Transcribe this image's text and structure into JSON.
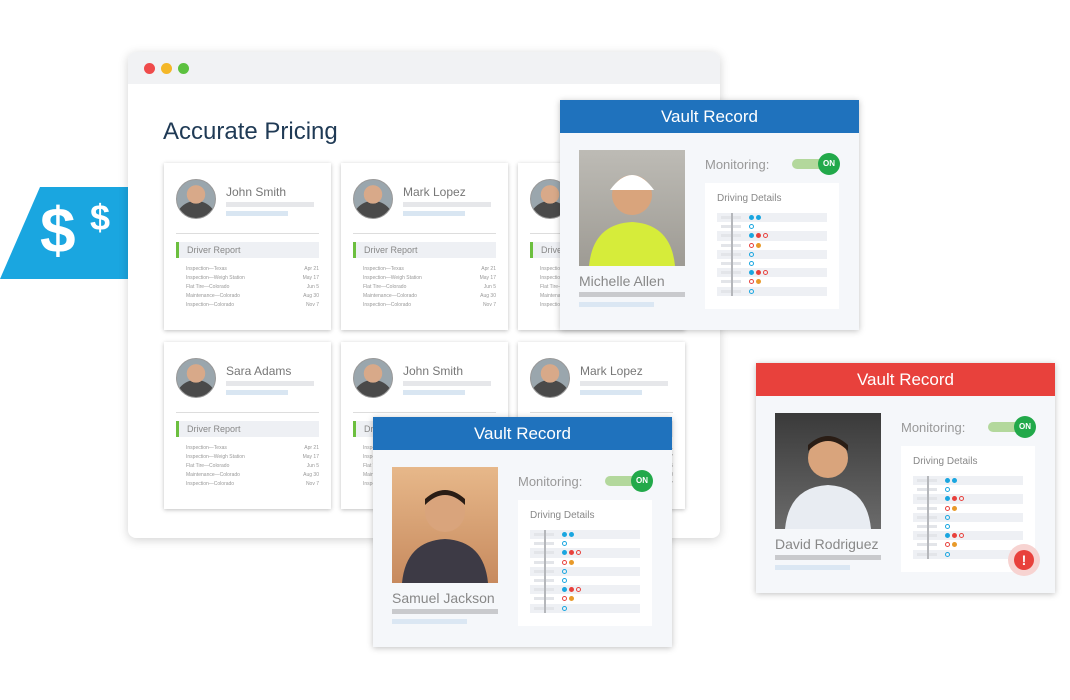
{
  "window": {
    "title": "Accurate Pricing",
    "dots": [
      "#ef4b4b",
      "#f4b728",
      "#5cc13f"
    ]
  },
  "price_tag": {
    "symbol_large": "$",
    "symbol_small": "$",
    "color": "#1aa6e0"
  },
  "cards": [
    {
      "name": "John Smith",
      "report": "Driver Report"
    },
    {
      "name": "Mark Lopez",
      "report": "Driver Report"
    },
    {
      "name": "",
      "report": "Driver Report"
    },
    {
      "name": "Sara Adams",
      "report": "Driver Report"
    },
    {
      "name": "John Smith",
      "report": "Driver Report"
    },
    {
      "name": "Mark Lopez",
      "report": "Driver Report"
    }
  ],
  "report_items": [
    {
      "label": "Inspection—Texas",
      "date": "Apr 21"
    },
    {
      "label": "Inspection—Weigh Station",
      "date": "May 17"
    },
    {
      "label": "Flat Tire—Colorado",
      "date": "Jun 5"
    },
    {
      "label": "Maintenance—Colorado",
      "date": "Aug 30"
    },
    {
      "label": "Inspection—Colorado",
      "date": "Nov 7"
    }
  ],
  "vaults": [
    {
      "title": "Vault Record",
      "name": "Michelle Allen",
      "monitoring_label": "Monitoring:",
      "toggle": "ON",
      "details_title": "Driving Details",
      "header_color": "#1f72bd",
      "alert": false
    },
    {
      "title": "Vault Record",
      "name": "Samuel Jackson",
      "monitoring_label": "Monitoring:",
      "toggle": "ON",
      "details_title": "Driving Details",
      "header_color": "#1f72bd",
      "alert": false
    },
    {
      "title": "Vault Record",
      "name": "David Rodriguez",
      "monitoring_label": "Monitoring:",
      "toggle": "ON",
      "details_title": "Driving Details",
      "header_color": "#e8413c",
      "alert": true
    }
  ],
  "detail_rows": [
    [
      "blue",
      "blue"
    ],
    [
      "blue-o"
    ],
    [
      "blue",
      "red",
      "red-o"
    ],
    [
      "red-o",
      "orange"
    ],
    [
      "blue-o"
    ],
    [
      "blue-o"
    ],
    [
      "blue",
      "red",
      "red-o"
    ],
    [
      "red-o",
      "orange"
    ],
    [
      "blue-o"
    ]
  ],
  "colors": {
    "blue": "#1aa6e0",
    "red": "#e8413c",
    "orange": "#e89a2a",
    "alert": "#e8413c"
  }
}
